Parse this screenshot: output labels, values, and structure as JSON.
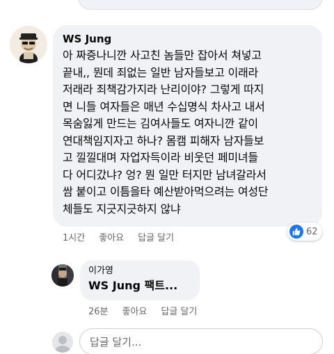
{
  "main_comment": {
    "author": "WS Jung",
    "text": "아 짜증나니깐 사고친 놈들만 잡아서 쳐넣고\n끝내,, 뭔데 죄없는 일반 남자들보고 이래라\n저래라 죄책감가지라 난리이야? 그렇게 따지\n면 니들 여자들은 매년 수십명식 차사고 내서\n목숨잃게 만드는 김여사들도 여자니깐 같이\n연대책임지자고 하나? 몸캠 피해자  남자들보\n고  낄낄대며 자업자득이라 비웃던 페미녀들\n다 어디갔냐? 엉? 뭔 일만 터지만 남녀갈라서\n쌈 붙이고 이틈을타 예산받아먹으려는 여성단\n체들도 지긋지긋하지 않냐",
    "time": "1시간",
    "like_label": "좋아요",
    "reply_label": "답글 달기",
    "reaction_count": "62"
  },
  "reply_comment": {
    "author": "이가영",
    "text": "WS Jung 팩트...",
    "time": "26분",
    "like_label": "좋아요",
    "reply_label": "답글 달기"
  },
  "reply_input": {
    "placeholder": "답글 달기..."
  }
}
